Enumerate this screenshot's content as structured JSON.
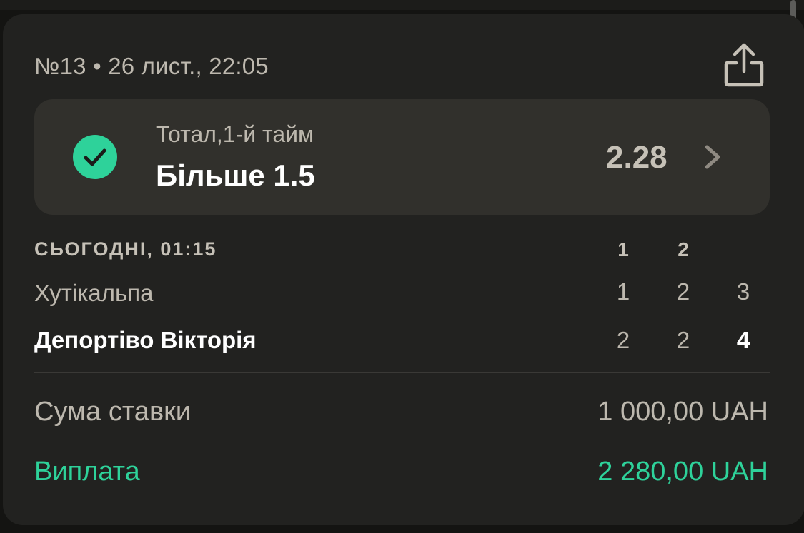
{
  "header": {
    "meta": "№13 • 26 лист., 22:05",
    "share_icon": "share-icon"
  },
  "bet": {
    "status_icon": "check-circle-icon",
    "status_color": "#2ed29a",
    "market": "Тотал,1-й тайм",
    "selection": "Більше 1.5",
    "odds": "2.28",
    "chevron_icon": "chevron-right-icon"
  },
  "match": {
    "date_label": "СЬОГОДНІ, 01:15",
    "period_headers": [
      "1",
      "2"
    ],
    "teams": [
      {
        "name": "Хутікальпа",
        "scores": [
          "1",
          "2"
        ],
        "total": "3"
      },
      {
        "name": "Депортіво Вікторія",
        "scores": [
          "2",
          "2"
        ],
        "total": "4"
      }
    ]
  },
  "summary": {
    "stake_label": "Сума ставки",
    "stake_value": "1 000,00 UAH",
    "payout_label": "Виплата",
    "payout_value": "2 280,00 UAH",
    "accent_color": "#2ed29a"
  }
}
